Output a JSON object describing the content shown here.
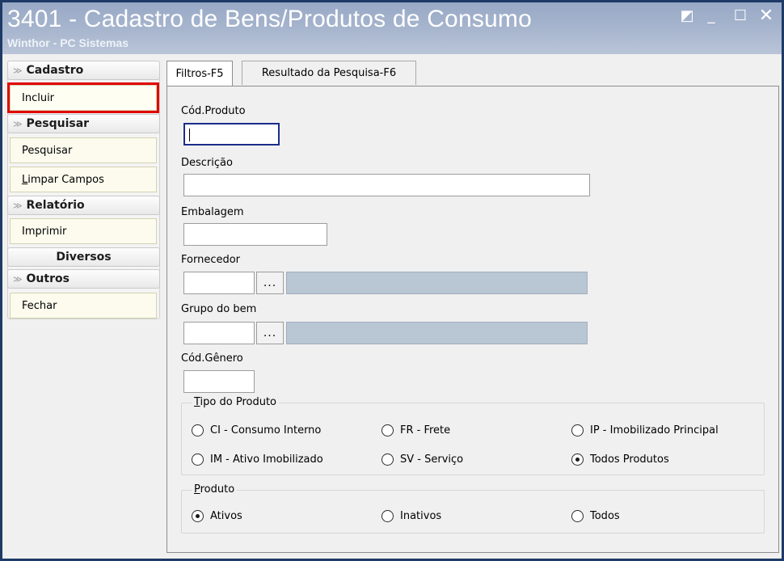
{
  "window": {
    "title": "3401 - Cadastro de Bens/Produtos de Consumo",
    "subtitle": "Winthor - PC Sistemas",
    "controls": {
      "restore": "◩",
      "minimize": "_",
      "maximize": "☐",
      "close": "✕"
    }
  },
  "sidebar": {
    "groups": [
      {
        "header": "Cadastro",
        "items": [
          "Incluir"
        ]
      },
      {
        "header": "Pesquisar",
        "items": [
          "Pesquisar",
          "Limpar Campos"
        ]
      },
      {
        "header": "Relatório",
        "items": [
          "Imprimir"
        ]
      },
      {
        "header": "Diversos",
        "items": []
      },
      {
        "header": "Outros",
        "items": [
          "Fechar"
        ]
      }
    ],
    "limpar_prefix": "L",
    "limpar_rest": "impar Campos",
    "selected_item": "Incluir",
    "highlight_color": "#e00000"
  },
  "tabs": [
    {
      "label": "Filtros-F5",
      "active": true
    },
    {
      "label": "Resultado da Pesquisa-F6",
      "active": false
    }
  ],
  "form": {
    "cod_produto": {
      "label": "Cód.Produto",
      "value": ""
    },
    "descricao": {
      "label": "Descrição",
      "value": ""
    },
    "embalagem": {
      "label": "Embalagem",
      "value": ""
    },
    "fornecedor": {
      "label": "Fornecedor",
      "value": "",
      "lookup": "...",
      "description": ""
    },
    "grupo_bem": {
      "label": "Grupo do bem",
      "value": "",
      "lookup": "...",
      "description": ""
    },
    "cod_genero": {
      "label": "Cód.Gênero",
      "value": ""
    }
  },
  "tipo_produto": {
    "legend_first": "T",
    "legend_rest": "ipo do Produto",
    "options": [
      "CI - Consumo Interno",
      "FR - Frete",
      "IP - Imobilizado Principal",
      "IM - Ativo Imobilizado",
      "SV - Serviço",
      "Todos Produtos"
    ],
    "selected": "Todos Produtos"
  },
  "produto": {
    "legend_first": "P",
    "legend_rest": "roduto",
    "options": [
      "Ativos",
      "Inativos",
      "Todos"
    ],
    "selected": "Ativos"
  },
  "colors": {
    "titlebar": "#a8b6ce",
    "readonly_field": "#b9c6d3",
    "focus_border": "#1b2d8a",
    "side_item_bg": "#fcfbee"
  }
}
